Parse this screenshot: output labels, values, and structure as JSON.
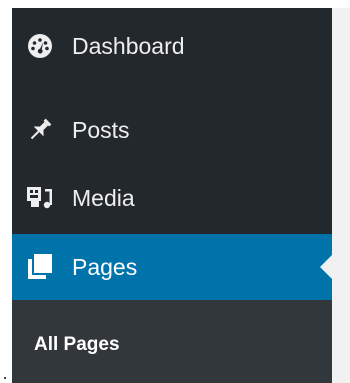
{
  "colors": {
    "sidebar_bg": "#23282d",
    "submenu_bg": "#32373c",
    "active_bg": "#0073aa",
    "content_bg": "#f1f1f1",
    "text": "#eeeeee"
  },
  "menu": {
    "items": [
      {
        "label": "Dashboard",
        "icon": "dashboard-icon"
      },
      {
        "label": "Posts",
        "icon": "pushpin-icon"
      },
      {
        "label": "Media",
        "icon": "media-icon"
      },
      {
        "label": "Pages",
        "icon": "pages-icon",
        "active": true
      }
    ]
  },
  "submenu": {
    "items": [
      {
        "label": "All Pages",
        "current": true
      }
    ]
  }
}
